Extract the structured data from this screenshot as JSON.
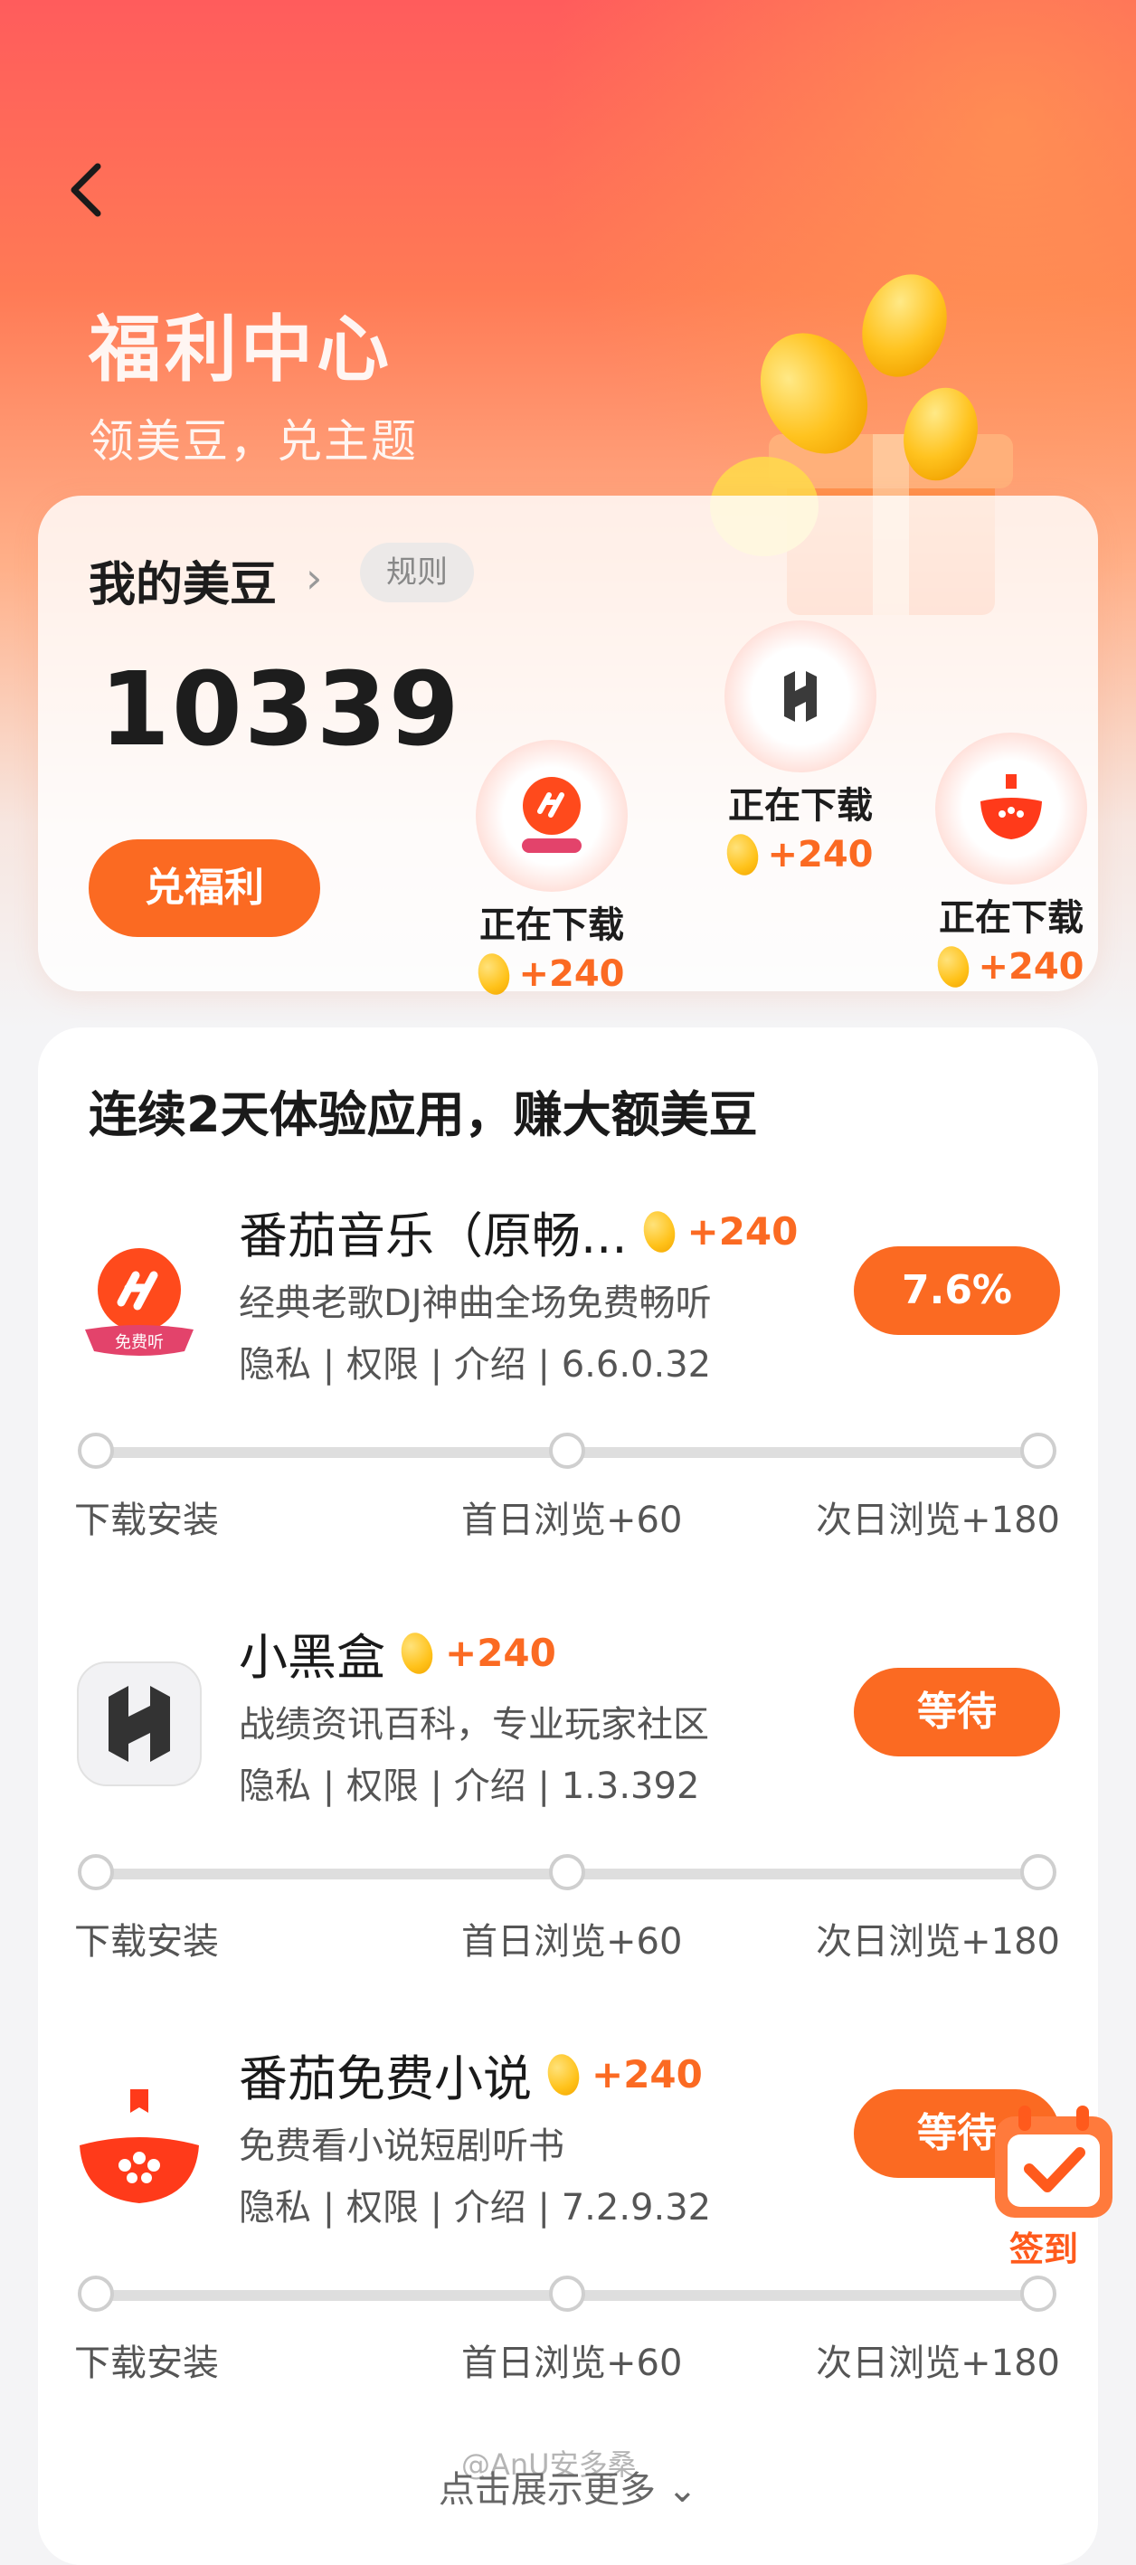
{
  "header": {
    "back_icon": "chevron-left-icon",
    "title": "福利中心",
    "subtitle": "领美豆，兑主题"
  },
  "beans": {
    "title": "我的美豆",
    "rules_label": "规则",
    "count": "10339",
    "redeem_label": "兑福利",
    "downloads": [
      {
        "app": "番茄音乐",
        "status": "正在下载",
        "reward": "+240"
      },
      {
        "app": "小黑盒",
        "status": "正在下载",
        "reward": "+240"
      },
      {
        "app": "番茄免费小说",
        "status": "正在下载",
        "reward": "+240"
      }
    ]
  },
  "tasks": {
    "heading": "连续2天体验应用，赚大额美豆",
    "apps": [
      {
        "name": "番茄音乐（原畅...",
        "reward": "+240",
        "desc": "经典老歌DJ神曲全场免费畅听",
        "meta": "隐私 | 权限 | 介绍 | 6.6.0.32",
        "action": "7.6%",
        "icon_badge": "免费听",
        "steps": [
          "下载安装",
          "首日浏览+60",
          "次日浏览+180"
        ]
      },
      {
        "name": "小黑盒",
        "reward": "+240",
        "desc": "战绩资讯百科，专业玩家社区",
        "meta": "隐私 | 权限 | 介绍 | 1.3.392",
        "action": "等待",
        "steps": [
          "下载安装",
          "首日浏览+60",
          "次日浏览+180"
        ]
      },
      {
        "name": "番茄免费小说",
        "reward": "+240",
        "desc": "免费看小说短剧听书",
        "meta": "隐私 | 权限 | 介绍 | 7.2.9.32",
        "action": "等待",
        "steps": [
          "下载安装",
          "首日浏览+60",
          "次日浏览+180"
        ]
      }
    ],
    "more_label": "点击展示更多"
  },
  "checkin": {
    "label": "签到"
  },
  "watermark": "@AnU安多桑",
  "colors": {
    "accent": "#fb6a22",
    "hero_top": "#ff5c5c"
  }
}
